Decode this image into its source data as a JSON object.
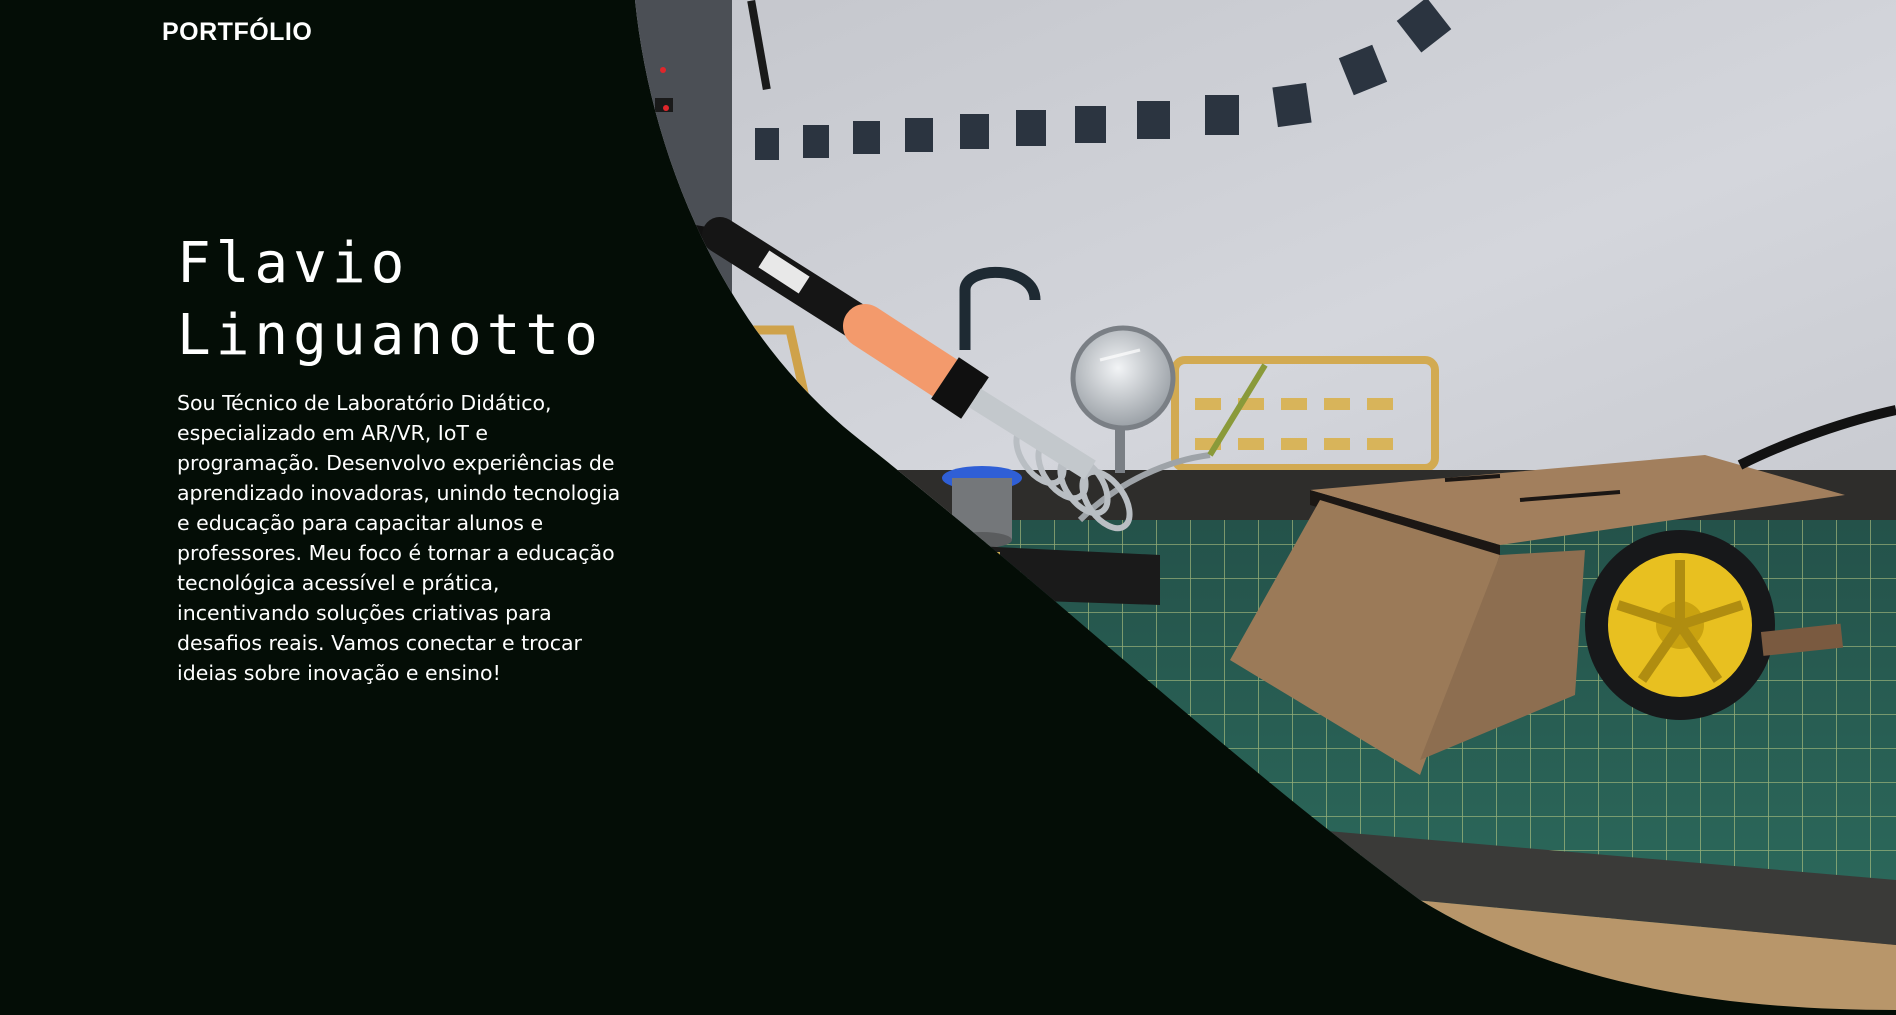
{
  "header": {
    "logo_text": "PORTFÓLIO"
  },
  "hero": {
    "title_line1": "Flavio",
    "title_line2": "Linguanotto",
    "bio": "Sou Técnico de Laboratório Didático, especializado em AR/VR, IoT e programação. Desenvolvo experiências de aprendizado inovadoras, unindo tecnologia e educação para capacitar alunos e professores. Meu foco é tornar a educação tecnológica acessível e prática, incentivando soluções criativas para desafios reais. Vamos conectar e trocar ideias sobre inovação e ensino!",
    "image_subject": "soldering-iron-and-robot-car-photo"
  },
  "colors": {
    "background": "#040d06",
    "text": "#ffffff"
  }
}
